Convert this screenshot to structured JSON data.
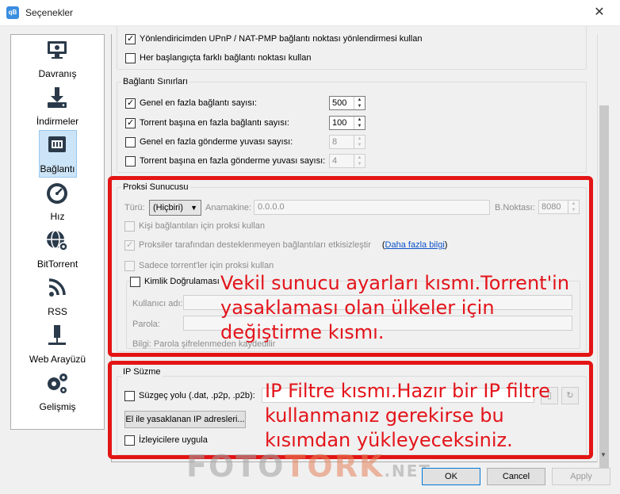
{
  "window": {
    "title": "Seçenekler",
    "app_icon": "qB"
  },
  "sidebar": {
    "items": [
      {
        "label": "Davranış",
        "icon": "monitor-icon"
      },
      {
        "label": "İndirmeler",
        "icon": "download-icon"
      },
      {
        "label": "Bağlantı",
        "icon": "network-icon",
        "active": true
      },
      {
        "label": "Hız",
        "icon": "speedometer-icon"
      },
      {
        "label": "BitTorrent",
        "icon": "globe-gear-icon"
      },
      {
        "label": "RSS",
        "icon": "rss-icon"
      },
      {
        "label": "Web Arayüzü",
        "icon": "network-port-icon"
      },
      {
        "label": "Gelişmiş",
        "icon": "gears-icon"
      }
    ]
  },
  "content": {
    "upnp_label": "Yönlendiricimden UPnP / NAT-PMP bağlantı noktası yönlendirmesi kullan",
    "random_port_label": "Her başlangıçta farklı bağlantı noktası kullan",
    "limits": {
      "title": "Bağlantı Sınırları",
      "global_max_label": "Genel en fazla bağlantı sayısı:",
      "global_max_value": "500",
      "per_torrent_label": "Torrent başına en fazla bağlantı sayısı:",
      "per_torrent_value": "100",
      "global_upload_label": "Genel en fazla gönderme yuvası sayısı:",
      "global_upload_value": "8",
      "per_torrent_upload_label": "Torrent başına en fazla gönderme yuvası sayısı:",
      "per_torrent_upload_value": "4"
    },
    "proxy": {
      "title": "Proksi Sunucusu",
      "type_label": "Türü:",
      "type_value": "(Hiçbiri)",
      "host_label": "Anamakine:",
      "host_value": "0.0.0.0",
      "port_label": "B.Noktası:",
      "port_value": "8080",
      "peer_label": "Kişi bağlantıları için proksi kullan",
      "disable_features_label": "Proksiler tarafından desteklenmeyen bağlantıları etkisizleştir",
      "more_info_link": "Daha fazla bilgi",
      "torrents_only_label": "Sadece torrent'ler için proksi kullan",
      "auth": {
        "title": "Kimlik Doğrulaması",
        "username_label": "Kullanıcı adı:",
        "password_label": "Parola:",
        "info_text": "Bilgi: Parola şifrelenmeden kaydedilir"
      }
    },
    "ip_filter": {
      "title": "IP Süzme",
      "filter_path_label": "Süzgeç yolu (.dat, .p2p, .p2b):",
      "manual_ban_button": "El ile yasaklanan IP adresleri...",
      "apply_to_trackers_label": "İzleyicilere uygula"
    }
  },
  "annotations": {
    "proxy_note": "Vekil sunucu ayarları kısmı.Torrent'in yasaklaması olan ülkeler için değiştirme kısmı.",
    "filter_note": "IP Filtre kısmı.Hazır bir IP filtre kullanmanız gerekirse bu kısımdan yükleyeceksiniz.",
    "annotation_color": "#e31414"
  },
  "watermark": {
    "part1": "FOTO",
    "part2": "TORK",
    "part3": ".NET"
  },
  "footer": {
    "ok": "OK",
    "cancel": "Cancel",
    "apply": "Apply"
  }
}
